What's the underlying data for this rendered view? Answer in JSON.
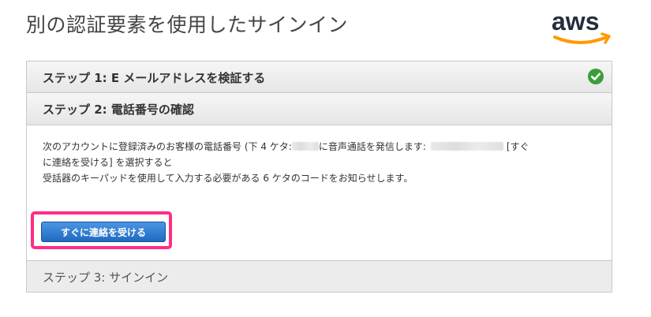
{
  "page": {
    "title": "別の認証要素を使用したサインイン"
  },
  "logo": {
    "text": "aws",
    "brand_color": "#ff9900",
    "text_color": "#232f3e"
  },
  "steps": [
    {
      "label": "ステップ 1: E メールアドレスを検証する",
      "status_icon": "check-circle-icon",
      "status_color": "#3a9e3a",
      "completed": true
    },
    {
      "label": "ステップ 2: 電話番号の確認"
    },
    {
      "label": "ステップ 3: サインイン"
    }
  ],
  "step2_body": {
    "line1_prefix": "次のアカウントに登録済みのお客様の電話番号 (下 4 ケタ:",
    "line1_middle": "に音声通話を発信します:",
    "line1_suffix": "[すぐ",
    "line2": "に連絡を受ける] を選択すると",
    "line3": "受話器のキーパッドを使用して入力する必要がある 6 ケタのコードをお知らせします。"
  },
  "callback_button": {
    "label": "すぐに連絡を受ける",
    "color": "#2f7fd6",
    "highlight_color": "#ff2d86"
  }
}
